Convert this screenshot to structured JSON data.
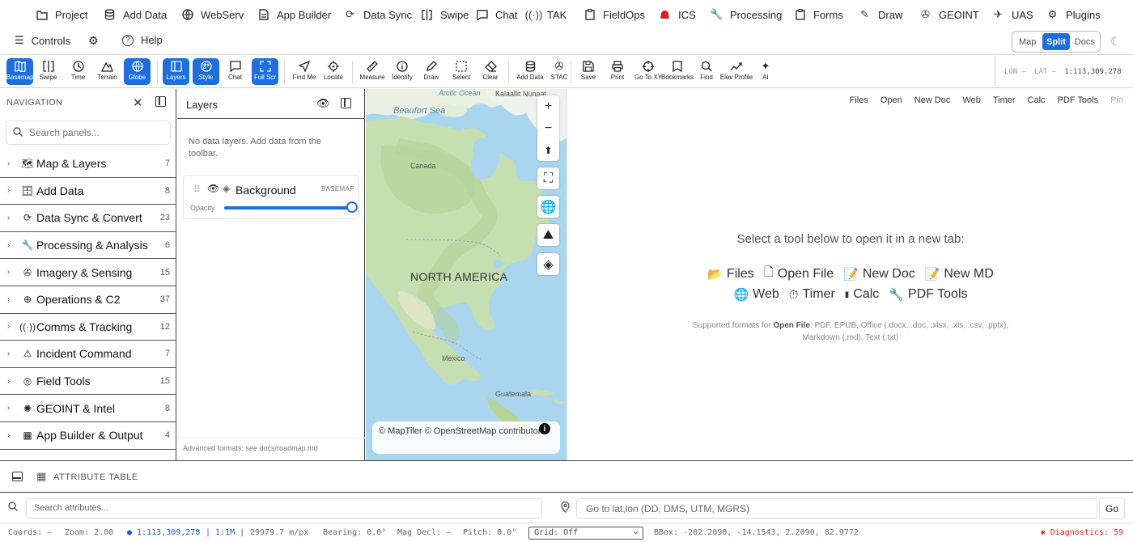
{
  "menubar": {
    "items": [
      {
        "label": "Project",
        "icon": "folder-icon"
      },
      {
        "label": "Add Data",
        "icon": "database-icon"
      },
      {
        "label": "WebServ",
        "icon": "globe-icon"
      },
      {
        "label": "App Builder",
        "icon": "document-icon"
      },
      {
        "label": "Data Sync",
        "icon": "sync-icon"
      },
      {
        "label": "Swipe",
        "icon": "swipe-icon"
      },
      {
        "label": "Chat",
        "icon": "chat-icon"
      },
      {
        "label": "TAK",
        "icon": "radio-icon"
      },
      {
        "label": "FieldOps",
        "icon": "clipboard-icon"
      },
      {
        "label": "ICS",
        "icon": "alert-icon"
      },
      {
        "label": "Processing",
        "icon": "wrench-icon"
      },
      {
        "label": "Forms",
        "icon": "clipboard-icon"
      },
      {
        "label": "Draw",
        "icon": "ruler-icon"
      },
      {
        "label": "GEOINT",
        "icon": "satellite-icon"
      },
      {
        "label": "UAS",
        "icon": "plane-icon"
      },
      {
        "label": "Plugins",
        "icon": "puzzle-icon"
      }
    ]
  },
  "bar2": {
    "controls_label": "Controls",
    "help_label": "Help",
    "modes": [
      "Map",
      "Split",
      "Docs"
    ],
    "active_mode": "Split"
  },
  "toolbar": {
    "items": [
      {
        "label": "Basemap",
        "active": true
      },
      {
        "label": "Swipe",
        "active": false
      },
      {
        "label": "Time",
        "active": false
      },
      {
        "label": "Terrain",
        "active": false
      },
      {
        "label": "Globe",
        "active": true
      },
      {
        "label": "Layers",
        "active": true
      },
      {
        "label": "Style",
        "active": true
      },
      {
        "label": "Chat",
        "active": false
      },
      {
        "label": "Full Scr",
        "active": true
      },
      {
        "label": "Find Me",
        "active": false
      },
      {
        "label": "Locate",
        "active": false
      },
      {
        "label": "Measure",
        "active": false
      },
      {
        "label": "Identify",
        "active": false
      },
      {
        "label": "Draw",
        "active": false
      },
      {
        "label": "Select",
        "active": false
      },
      {
        "label": "Clear",
        "active": false
      },
      {
        "label": "Add Data",
        "active": false
      },
      {
        "label": "STAC",
        "active": false
      },
      {
        "label": "Save",
        "active": false
      },
      {
        "label": "Print",
        "active": false
      },
      {
        "label": "Go To XY",
        "active": false
      },
      {
        "label": "Bookmarks",
        "active": false
      },
      {
        "label": "Find",
        "active": false
      },
      {
        "label": "Elev Profile",
        "active": false
      },
      {
        "label": "AI",
        "active": false
      }
    ],
    "lon_label": "LON —",
    "lat_label": "LAT —",
    "scale": "1:113,309,278"
  },
  "nav": {
    "title": "NAVIGATION",
    "search_placeholder": "Search panels...",
    "items": [
      {
        "label": "Map & Layers",
        "count": "7",
        "icon": "map-icon"
      },
      {
        "label": "Add Data",
        "count": "8",
        "icon": "database-icon"
      },
      {
        "label": "Data Sync & Convert",
        "count": "23",
        "icon": "sync-icon"
      },
      {
        "label": "Processing & Analysis",
        "count": "6",
        "icon": "wrench-icon"
      },
      {
        "label": "Imagery & Sensing",
        "count": "15",
        "icon": "satellite-icon"
      },
      {
        "label": "Operations & C2",
        "count": "37",
        "icon": "crosshair-icon"
      },
      {
        "label": "Comms & Tracking",
        "count": "12",
        "icon": "radio-icon"
      },
      {
        "label": "Incident Command",
        "count": "7",
        "icon": "warning-icon"
      },
      {
        "label": "Field Tools",
        "count": "15",
        "icon": "compass-icon"
      },
      {
        "label": "GEOINT & Intel",
        "count": "8",
        "icon": "brain-icon"
      },
      {
        "label": "App Builder & Output",
        "count": "4",
        "icon": "grid-icon"
      }
    ]
  },
  "layers": {
    "title": "Layers",
    "empty_text": "No data layers. Add data from the toolbar.",
    "background_name": "Background",
    "background_tag": "BASEMAP",
    "opacity_label": "Opacity",
    "opacity_value": 1.0,
    "footer": "Advanced formats: see docs/roadmap.md"
  },
  "map": {
    "labels": {
      "arctic": "Arctic Ocean",
      "kalaallit": "Kalaallit Nunaat",
      "beaufort": "Beaufort Sea",
      "canada": "Canada",
      "na": "NORTH AMERICA",
      "mexico": "México",
      "guatemala": "Guatemala"
    },
    "attribution": "© MapTiler © OpenStreetMap contributors"
  },
  "docs": {
    "tabs": [
      "Files",
      "Open",
      "New Doc",
      "Web",
      "Timer",
      "Calc",
      "PDF Tools",
      "Pin"
    ],
    "prompt": "Select a tool below to open it in a new tab:",
    "tools_row1": [
      {
        "label": "Files",
        "icon": "📂"
      },
      {
        "label": "Open File",
        "icon": "🗋"
      },
      {
        "label": "New Doc",
        "icon": "📝"
      },
      {
        "label": "New MD",
        "icon": "📝"
      }
    ],
    "tools_row2": [
      {
        "label": "Web",
        "icon": "🌐"
      },
      {
        "label": "Timer",
        "icon": "⏱"
      },
      {
        "label": "Calc",
        "icon": "▮"
      },
      {
        "label": "PDF Tools",
        "icon": "🔧"
      }
    ],
    "note_prefix": "Supported formats for ",
    "note_bold": "Open File",
    "note_suffix": ": PDF, EPUB, Office (.docx, .doc, .xlsx, .xls, .csv, .pptx), Markdown (.md), Text (.txt)"
  },
  "attribute": {
    "title": "ATTRIBUTE TABLE",
    "search_placeholder": "Search attributes...",
    "goto_placeholder": "Go to lat,lon (DD, DMS, UTM, MGRS)",
    "go_label": "Go"
  },
  "status": {
    "coords": "Coords: —",
    "zoom": "Zoom: 2.00",
    "scale": "● 1:113,309,278",
    "ratio": "| 1:1M |",
    "mpp": "29979.7 m/px",
    "bearing": "Bearing: 0.0°",
    "magdecl": "Mag Decl: —",
    "pitch": "Pitch: 0.0°",
    "grid": "Grid: Off",
    "bbox": "BBox: -202.2090, -14.1543, 2.2090, 82.9772",
    "diagnostics": "Diagnostics: 59"
  }
}
